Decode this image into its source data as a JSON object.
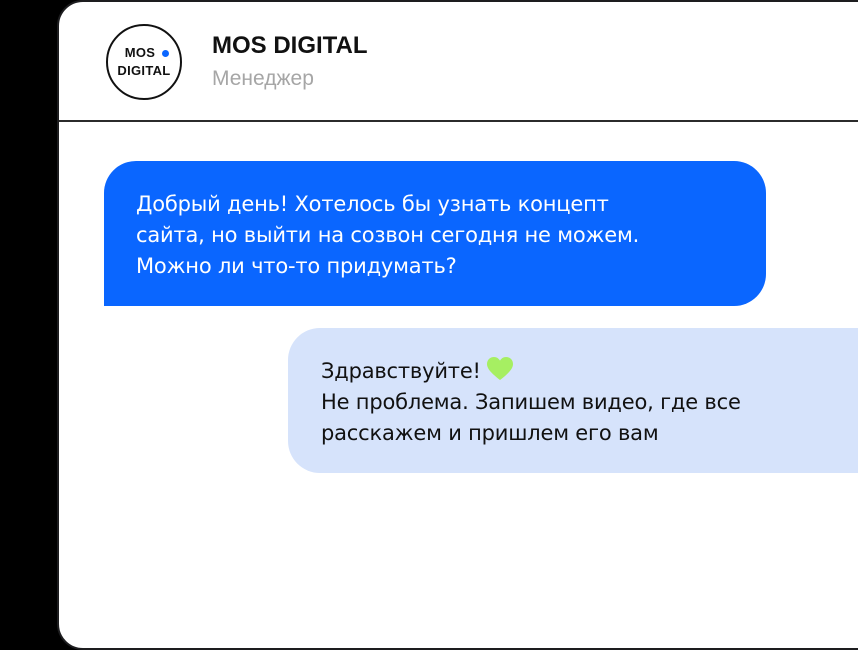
{
  "contact": {
    "avatar_line1": "MOS",
    "avatar_line2": "DIGITAL",
    "name": "MOS DIGITAL",
    "role": "Менеджер"
  },
  "messages": [
    {
      "direction": "incoming",
      "lines": [
        "Добрый день! Хотелось бы узнать концепт",
        "сайта, но выйти на созвон сегодня не можем.",
        "Можно ли что-то придумать?"
      ]
    },
    {
      "direction": "outgoing",
      "lines": [
        "Здравствуйте!",
        "Не проблема. Запишем видео, где все",
        "расскажем и пришлем его вам"
      ],
      "emoji_icon": "green-heart-icon"
    }
  ],
  "colors": {
    "accent_blue": "#0a66ff",
    "outgoing_bubble": "#d6e3fb",
    "heart_green": "#a6ef62",
    "role_gray": "#a6a6a6"
  }
}
